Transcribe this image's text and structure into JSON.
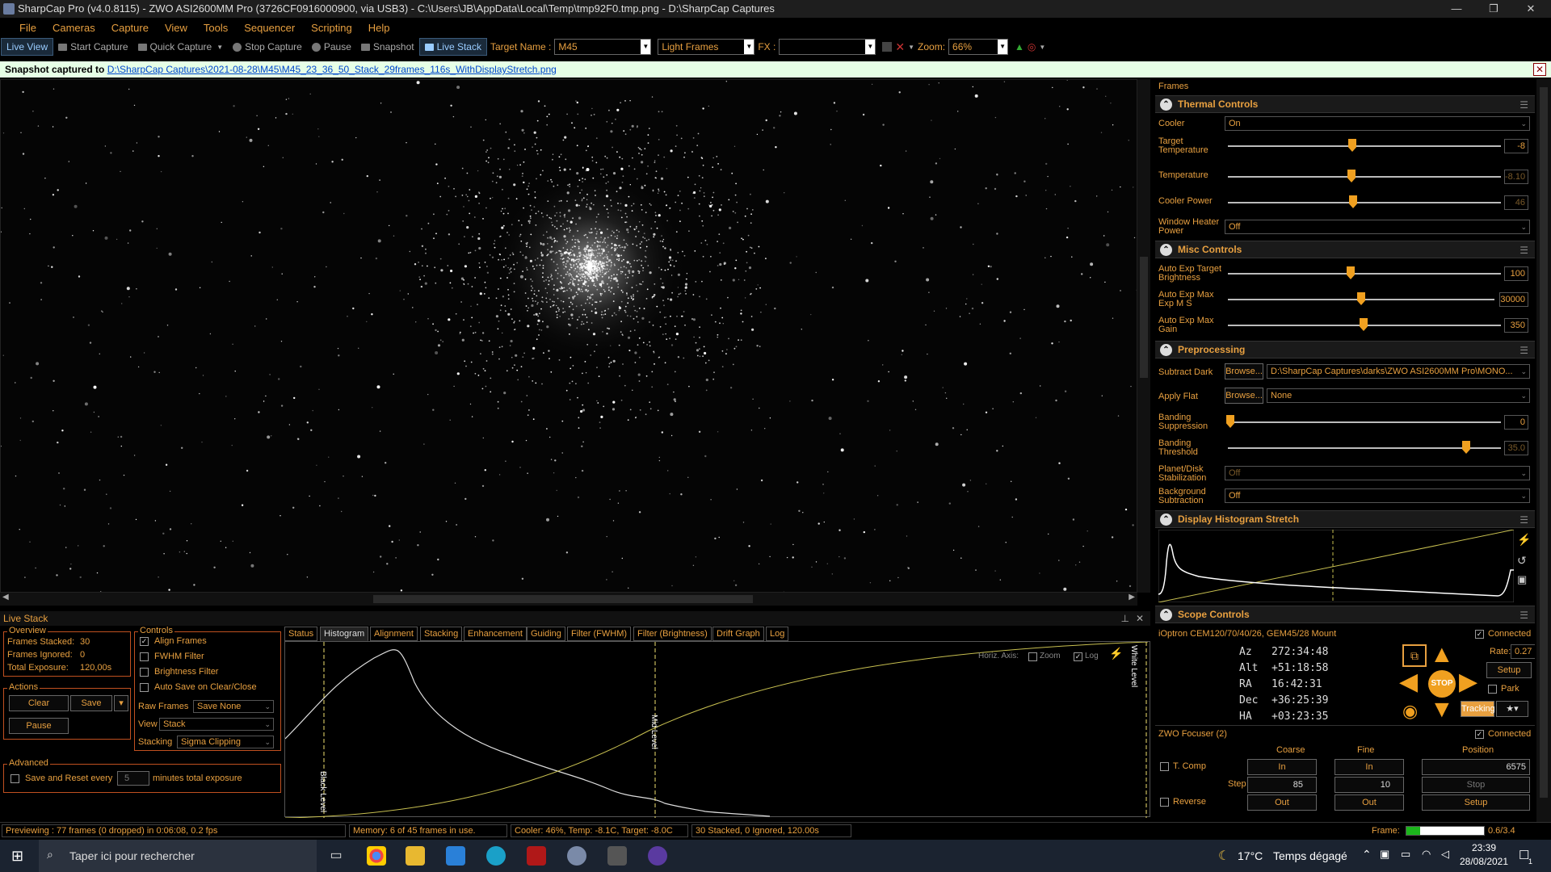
{
  "window": {
    "title": "SharpCap Pro (v4.0.8115) - ZWO ASI2600MM Pro (3726CF0916000900, via USB3) - C:\\Users\\JB\\AppData\\Local\\Temp\\tmp92F0.tmp.png - D:\\SharpCap Captures",
    "min": "—",
    "max": "❐",
    "close": "✕"
  },
  "menu": [
    "File",
    "Cameras",
    "Capture",
    "View",
    "Tools",
    "Sequencer",
    "Scripting",
    "Help"
  ],
  "toolbar": {
    "live_view": "Live View",
    "start_capture": "Start Capture",
    "quick_capture": "Quick Capture",
    "stop_capture": "Stop Capture",
    "pause": "Pause",
    "snapshot": "Snapshot",
    "live_stack": "Live Stack",
    "target_label": "Target Name :",
    "target_value": "M45",
    "frame_type": "Light Frames",
    "fx_label": "FX :",
    "fx_value": "",
    "zoom_label": "Zoom:",
    "zoom_value": "66%"
  },
  "notification": {
    "prefix": "Snapshot captured to",
    "path": "D:\\SharpCap Captures\\2021-08-28\\M45\\M45_23_36_50_Stack_29frames_116s_WithDisplayStretch.png",
    "close": "✕"
  },
  "right_panel": {
    "frames_label": "Frames",
    "thermal": {
      "title": "Thermal Controls",
      "cooler_label": "Cooler",
      "cooler_value": "On",
      "target_temp_label": "Target Temperature",
      "target_temp_value": "-8",
      "temperature_label": "Temperature",
      "temperature_value": "-8.10",
      "cooler_power_label": "Cooler Power",
      "cooler_power_value": "46",
      "heater_label": "Window Heater Power",
      "heater_value": "Off"
    },
    "misc": {
      "title": "Misc Controls",
      "aetb_label": "Auto Exp Target Brightness",
      "aetb_value": "100",
      "aeme_label": "Auto Exp Max Exp M S",
      "aeme_value": "30000",
      "aemg_label": "Auto Exp Max Gain",
      "aemg_value": "350"
    },
    "preprocessing": {
      "title": "Preprocessing",
      "dark_label": "Subtract Dark",
      "browse": "Browse...",
      "dark_value": "D:\\SharpCap Captures\\darks\\ZWO ASI2600MM Pro\\MONO...",
      "flat_label": "Apply Flat",
      "flat_value": "None",
      "banding_sup_label": "Banding Suppression",
      "banding_sup_value": "0",
      "banding_thr_label": "Banding Threshold",
      "banding_thr_value": "35.0",
      "planet_label": "Planet/Disk Stabilization",
      "planet_value": "Off",
      "bg_label": "Background Subtraction",
      "bg_value": "Off"
    },
    "stretch": {
      "title": "Display Histogram Stretch"
    },
    "scope": {
      "title": "Scope Controls",
      "mount": "iOptron CEM120/70/40/26, GEM45/28 Mount",
      "connected": "Connected",
      "az_label": "Az",
      "az": "272:34:48",
      "alt_label": "Alt",
      "alt": "+51:18:58",
      "ra_label": "RA",
      "ra": "16:42:31",
      "dec_label": "Dec",
      "dec": "+36:25:39",
      "ha_label": "HA",
      "ha": "+03:23:35",
      "rate_label": "Rate:",
      "rate": "0.27",
      "setup": "Setup",
      "park": "Park",
      "stop": "STOP",
      "tracking": "Tracking"
    },
    "focuser": {
      "title": "ZWO Focuser (2)",
      "connected": "Connected",
      "coarse": "Coarse",
      "fine": "Fine",
      "position": "Position",
      "tcomp": "T. Comp",
      "in": "In",
      "position_value": "6575",
      "step_size": "Step Size",
      "coarse_step": "85",
      "fine_step": "10",
      "stop": "Stop",
      "reverse": "Reverse",
      "out": "Out",
      "setup": "Setup"
    }
  },
  "live_stack": {
    "title": "Live Stack",
    "overview": {
      "title": "Overview",
      "frames_stacked_label": "Frames Stacked:",
      "frames_stacked": "30",
      "frames_ignored_label": "Frames Ignored:",
      "frames_ignored": "0",
      "total_exposure_label": "Total Exposure:",
      "total_exposure": "120,00s"
    },
    "actions": {
      "title": "Actions",
      "clear": "Clear",
      "save": "Save",
      "pause": "Pause"
    },
    "controls": {
      "title": "Controls",
      "align": "Align Frames",
      "fwhm": "FWHM Filter",
      "brightness": "Brightness Filter",
      "autosave": "Auto Save on Clear/Close",
      "raw_label": "Raw Frames",
      "raw_value": "Save None",
      "view_label": "View",
      "view_value": "Stack",
      "stacking_label": "Stacking",
      "stacking_value": "Sigma Clipping"
    },
    "advanced": {
      "title": "Advanced",
      "save_reset": "Save and Reset every",
      "minutes": "5",
      "suffix": "minutes total exposure"
    },
    "tabs": [
      "Status",
      "Histogram",
      "Alignment",
      "Stacking",
      "Enhancement",
      "Guiding",
      "Filter (FWHM)",
      "Filter (Brightness)",
      "Drift Graph",
      "Log"
    ],
    "histogram": {
      "horiz_axis": "Horiz. Axis:",
      "zoom": "Zoom",
      "log": "Log",
      "black_level": "Black Level",
      "mid_level": "Mid Level",
      "white_level": "White Level"
    }
  },
  "status": {
    "previewing": "Previewing : 77 frames (0 dropped) in 0:06:08, 0.2 fps",
    "memory": "Memory: 6 of 45 frames in use.",
    "cooler": "Cooler: 46%, Temp: -8.1C, Target: -8.0C",
    "stacked": "30 Stacked, 0 Ignored, 120.00s",
    "frame_label": "Frame:",
    "frame_value": "0.6/3.4"
  },
  "taskbar": {
    "search_placeholder": "Taper ici pour rechercher",
    "temp": "17°C",
    "weather": "Temps dégagé",
    "time": "23:39",
    "date": "28/08/2021",
    "notifications": "1"
  }
}
